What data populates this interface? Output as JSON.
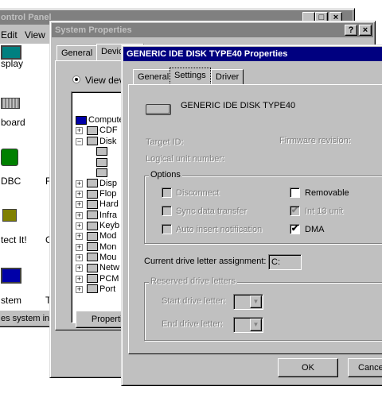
{
  "control_panel": {
    "title": "ontrol Panel",
    "menu": [
      "Edit",
      "View"
    ],
    "icons": [
      {
        "label": "splay",
        "icon": "display-icon"
      },
      {
        "label": "board",
        "icon": "keyboard-icon"
      },
      {
        "label": "DBC",
        "icon": "odbc-icon"
      },
      {
        "label": "tect It!",
        "icon": "lock-icon"
      },
      {
        "label": "stem",
        "icon": "system-icon"
      }
    ],
    "side_letters": [
      "F",
      "G",
      "T"
    ],
    "status": "es system info"
  },
  "system_properties": {
    "title": "System Properties",
    "tabs": [
      "General",
      "Devic"
    ],
    "radio_label": "View dev",
    "tree": [
      "Compute",
      "CDF",
      "Disk",
      "",
      "",
      "",
      "Disp",
      "Flop",
      "Hard",
      "Infra",
      "Keyb",
      "Mod",
      "Mon",
      "Mou",
      "Netw",
      "PCM",
      "Port"
    ],
    "properties_button": "Properties"
  },
  "disk_properties": {
    "title": "GENERIC IDE  DISK TYPE40 Properties",
    "tabs": [
      "General",
      "Settings",
      "Driver"
    ],
    "device_name": "GENERIC IDE  DISK TYPE40",
    "target_id_label": "Target ID:",
    "firmware_label": "Firmware revision:",
    "lun_label": "Logical unit number:",
    "options_legend": "Options",
    "options": [
      {
        "label": "Disconnect",
        "checked": false,
        "enabled": false
      },
      {
        "label": "Removable",
        "checked": false,
        "enabled": true
      },
      {
        "label": "Sync data transfer",
        "checked": false,
        "enabled": false
      },
      {
        "label": "Int 13 unit",
        "checked": true,
        "enabled": false
      },
      {
        "label": "Auto insert notification",
        "checked": false,
        "enabled": false
      },
      {
        "label": "DMA",
        "checked": true,
        "enabled": true
      }
    ],
    "current_drive_label": "Current drive letter assignment:",
    "current_drive_value": "C:",
    "reserved_legend": "Reserved drive letters",
    "start_label": "Start drive letter:",
    "end_label": "End drive letter:",
    "ok_button": "OK",
    "cancel_button": "Cance"
  },
  "help_button": "?",
  "close_button": "×",
  "min_button": "_",
  "max_button": "□",
  "check_mark": "✔",
  "plus_sign": "+",
  "minus_sign": "−",
  "colors": {
    "active_title": "#000080",
    "inactive_title": "#808080",
    "face": "#c0c0c0"
  }
}
